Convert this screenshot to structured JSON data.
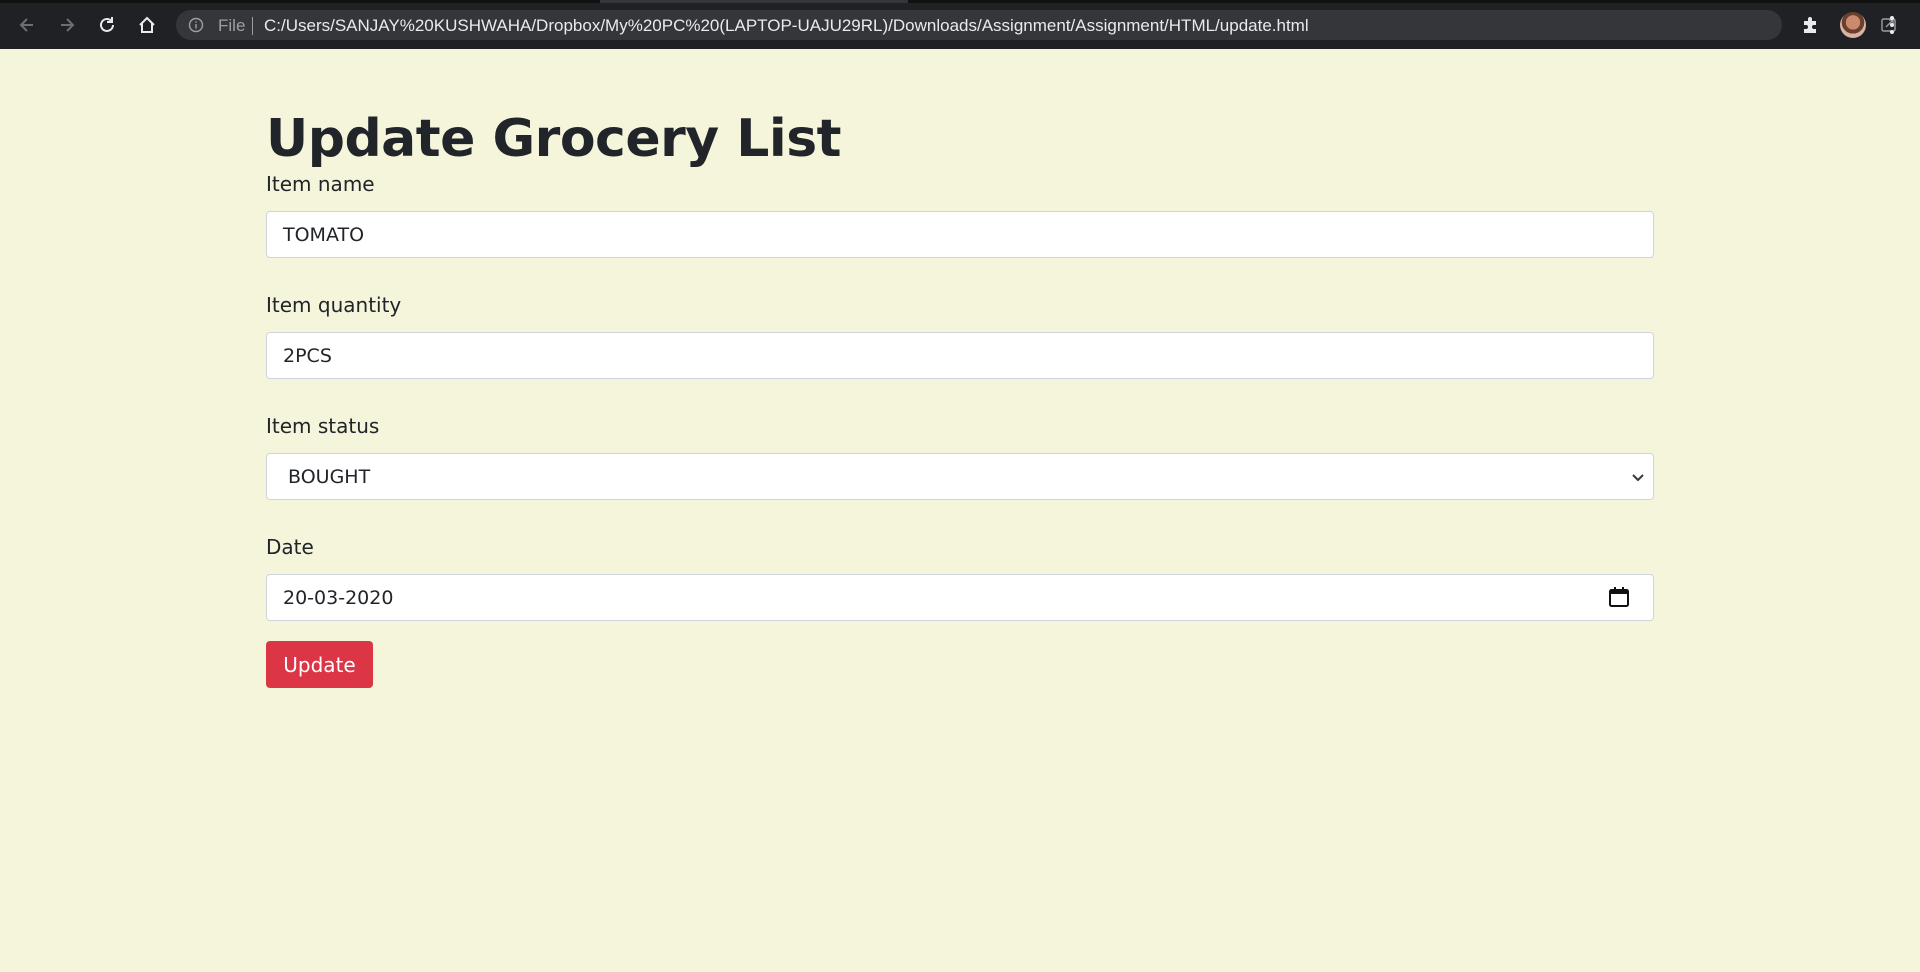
{
  "browser": {
    "file_label": "File",
    "url": "C:/Users/SANJAY%20KUSHWAHA/Dropbox/My%20PC%20(LAPTOP-UAJU29RL)/Downloads/Assignment/Assignment/HTML/update.html"
  },
  "page": {
    "title": "Update Grocery List"
  },
  "form": {
    "name_label": "Item name",
    "name_value": "TOMATO",
    "quantity_label": "Item quantity",
    "quantity_value": "2PCS",
    "status_label": "Item status",
    "status_value": "BOUGHT",
    "date_label": "Date",
    "date_value": "20-03-2020",
    "submit_label": "Update"
  },
  "colors": {
    "page_background": "#f5f5dc",
    "button": "#dc3545",
    "chrome": "#202124"
  }
}
